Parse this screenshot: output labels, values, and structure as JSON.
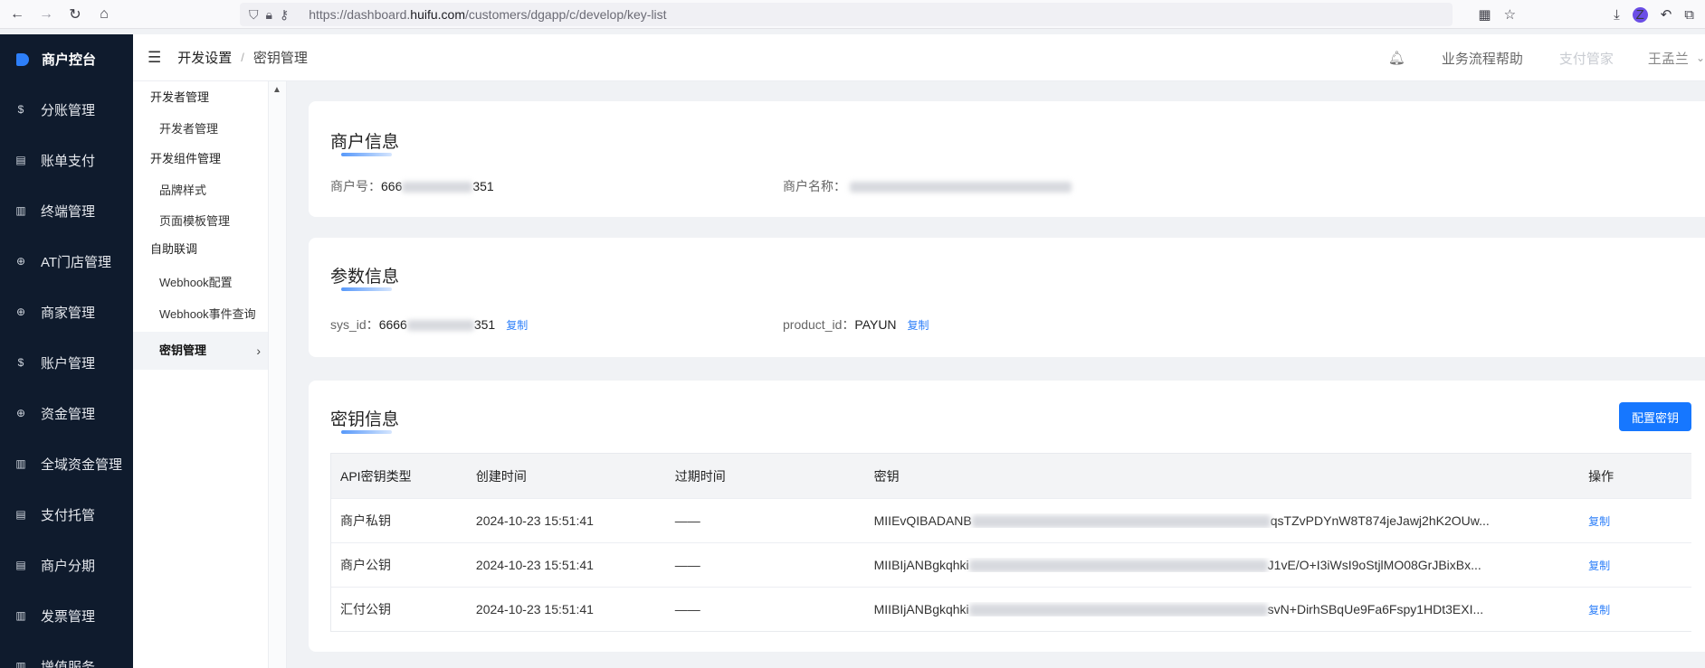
{
  "browser": {
    "url_prefix": "https://dashboard.",
    "url_domain": "huifu.com",
    "url_path": "/customers/dgapp/c/develop/key-list",
    "profile_letter": "Z"
  },
  "sidebar": {
    "brand": "商户控台",
    "items": [
      {
        "label": "分账管理",
        "icon": "$"
      },
      {
        "label": "账单支付",
        "icon": "▤"
      },
      {
        "label": "终端管理",
        "icon": "▥"
      },
      {
        "label": "AT门店管理",
        "icon": "⊕"
      },
      {
        "label": "商家管理",
        "icon": "⊕"
      },
      {
        "label": "账户管理",
        "icon": "$"
      },
      {
        "label": "资金管理",
        "icon": "⊕"
      },
      {
        "label": "全域资金管理",
        "icon": "▥"
      },
      {
        "label": "支付托管",
        "icon": "▤"
      },
      {
        "label": "商户分期",
        "icon": "▤"
      },
      {
        "label": "发票管理",
        "icon": "▥"
      },
      {
        "label": "增值服务",
        "icon": "▥"
      }
    ]
  },
  "topbar": {
    "breadcrumb_1": "开发设置",
    "breadcrumb_sep": "/",
    "breadcrumb_2": "密钥管理",
    "help": "业务流程帮助",
    "pay_manager": "支付管家",
    "user": "王孟兰"
  },
  "subnav": {
    "group_dev": "开发者管理",
    "item_dev": "开发者管理",
    "group_comp": "开发组件管理",
    "item_brand": "品牌样式",
    "item_template": "页面模板管理",
    "group_self": "自助联调",
    "item_webhook": "Webhook配置",
    "item_webhook_query": "Webhook事件查询",
    "item_key": "密钥管理"
  },
  "merchant": {
    "title": "商户信息",
    "id_label": "商户号：",
    "id_prefix": "666",
    "id_suffix": "351",
    "name_label": "商户名称："
  },
  "params": {
    "title": "参数信息",
    "sys_label": "sys_id：",
    "sys_prefix": "6666",
    "sys_suffix": "351",
    "copy": "复制",
    "product_label": "product_id：",
    "product_value": "PAYUN"
  },
  "keys": {
    "title": "密钥信息",
    "config_button": "配置密钥",
    "columns": [
      "API密钥类型",
      "创建时间",
      "过期时间",
      "密钥",
      "操作"
    ],
    "rows": [
      {
        "type": "商户私钥",
        "created": "2024-10-23 15:51:41",
        "expire": "——",
        "key_prefix": "MIIEvQIBADANB",
        "key_suffix": "qsTZvPDYnW8T874jeJawj2hK2OUw...",
        "action": "复制"
      },
      {
        "type": "商户公钥",
        "created": "2024-10-23 15:51:41",
        "expire": "——",
        "key_prefix": "MIIBIjANBgkqhki",
        "key_suffix": "J1vE/O+I3iWsI9oStjlMO08GrJBixBx...",
        "action": "复制"
      },
      {
        "type": "汇付公钥",
        "created": "2024-10-23 15:51:41",
        "expire": "——",
        "key_prefix": "MIIBIjANBgkqhki",
        "key_suffix": "svN+DirhSBqUe9Fa6Fspy1HDt3EXI...",
        "action": "复制"
      }
    ]
  }
}
